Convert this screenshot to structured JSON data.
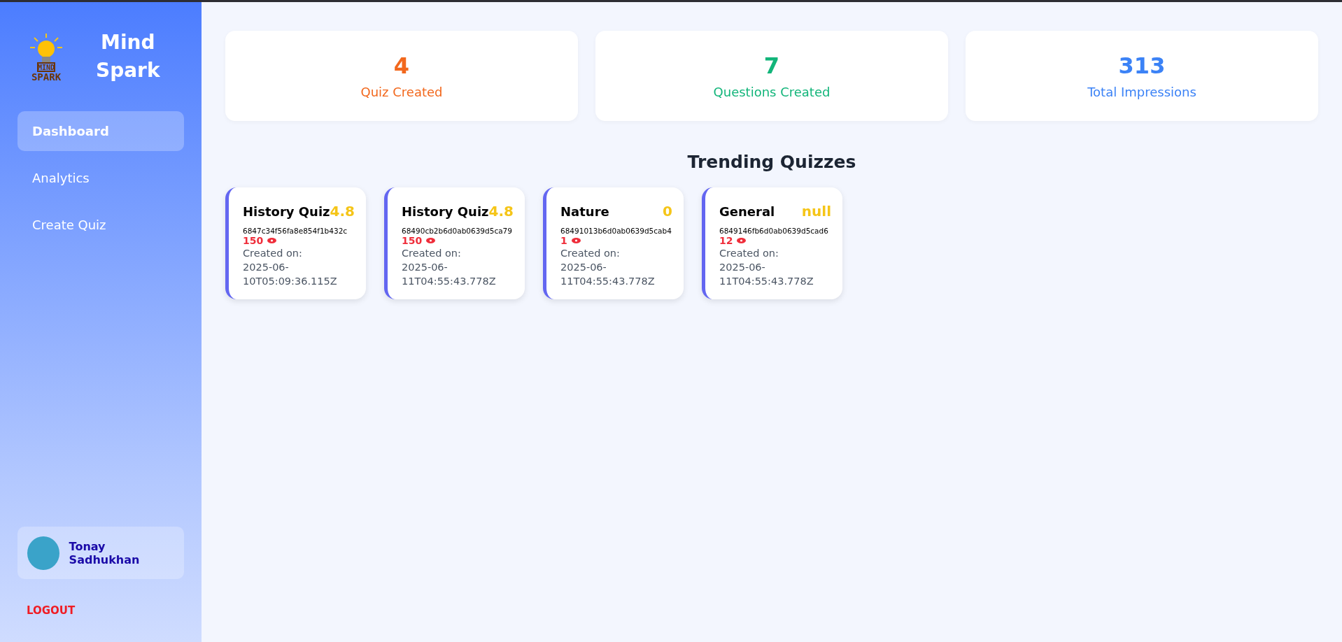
{
  "sidebar": {
    "logo": {
      "top": "MIND",
      "bottom": "SPARK"
    },
    "brand": [
      "Mind",
      "Spark"
    ],
    "items": [
      {
        "label": "Dashboard",
        "selected": true
      },
      {
        "label": "Analytics",
        "selected": false
      },
      {
        "label": "Create Quiz",
        "selected": false
      }
    ],
    "user": {
      "name": "Tonay Sadhukhan"
    },
    "logout": "LOGOUT"
  },
  "stats": [
    {
      "value": "4",
      "label": "Quiz Created",
      "color": "#f2681d"
    },
    {
      "value": "7",
      "label": "Questions Created",
      "color": "#12b57a"
    },
    {
      "value": "313",
      "label": "Total Impressions",
      "color": "#3b82f6"
    }
  ],
  "trending": {
    "title": "Trending Quizzes",
    "quizzes": [
      {
        "name": "History Quiz",
        "rating": "4.8",
        "id": "6847c34f56fa8e854f1b432c",
        "views": "150",
        "created_label": "Created on:",
        "created": "2025-06-10T05:09:36.115Z"
      },
      {
        "name": "History Quiz",
        "rating": "4.8",
        "id": "68490cb2b6d0ab0639d5ca79",
        "views": "150",
        "created_label": "Created on:",
        "created": "2025-06-11T04:55:43.778Z"
      },
      {
        "name": "Nature",
        "rating": "0",
        "id": "68491013b6d0ab0639d5cab4",
        "views": "1",
        "created_label": "Created on:",
        "created": "2025-06-11T04:55:43.778Z"
      },
      {
        "name": "General",
        "rating": "null",
        "id": "6849146fb6d0ab0639d5cad6",
        "views": "12",
        "created_label": "Created on:",
        "created": "2025-06-11T04:55:43.778Z"
      }
    ]
  }
}
